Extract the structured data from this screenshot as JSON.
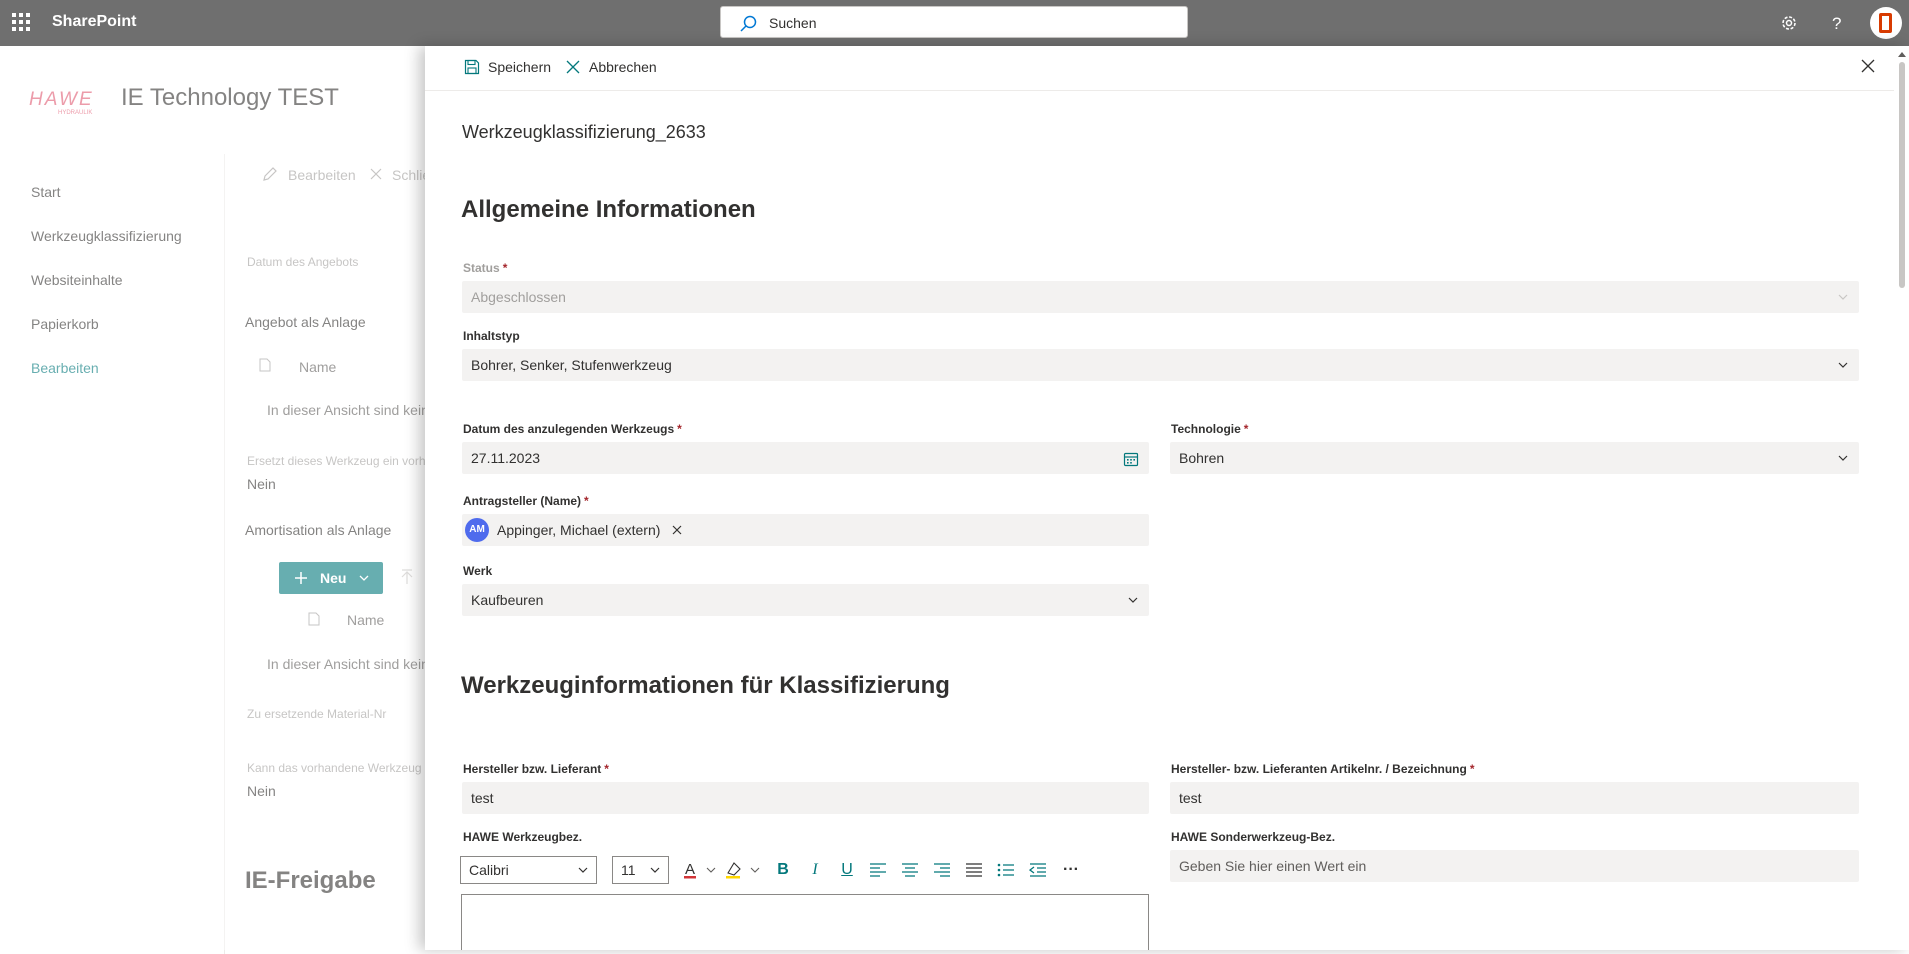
{
  "suitebar": {
    "app_name": "SharePoint",
    "search_placeholder": "Suchen"
  },
  "site": {
    "title": "IE Technology TEST",
    "logo_text": "HAWE",
    "logo_subtext": "HYDRAULIK"
  },
  "leftnav": {
    "items": [
      "Start",
      "Werkzeugklassifizierung",
      "Websiteinhalte",
      "Papierkorb",
      "Bearbeiten"
    ]
  },
  "background": {
    "cmd_edit": "Bearbeiten",
    "cmd_close": "Schlie",
    "datum_angebot_label": "Datum des Angebots",
    "angebot_anlage": "Angebot als Anlage",
    "name_col": "Name",
    "empty_view": "In dieser Ansicht sind kein",
    "ersetzt_label": "Ersetzt dieses Werkzeug ein vorh",
    "nein_1": "Nein",
    "amortisation": "Amortisation als Anlage",
    "neu_button": "Neu",
    "name_col_2": "Name",
    "empty_view_2": "In dieser Ansicht sind kein",
    "material_label": "Zu ersetzende Material-Nr",
    "kann_label": "Kann das vorhandene Werkzeug",
    "nein_2": "Nein",
    "ie_freigabe": "IE-Freigabe"
  },
  "panel": {
    "save_label": "Speichern",
    "cancel_label": "Abbrechen",
    "form_title": "Werkzeugklassifizierung_2633",
    "section_general": "Allgemeine Informationen",
    "section_tool": "Werkzeuginformationen für Klassifizierung",
    "fields": {
      "status": {
        "label": "Status",
        "value": "Abgeschlossen"
      },
      "inhaltstyp": {
        "label": "Inhaltstyp",
        "value": "Bohrer,  Senker, Stufenwerkzeug"
      },
      "datum": {
        "label": "Datum des anzulegenden Werkzeugs",
        "value": "27.11.2023"
      },
      "technologie": {
        "label": "Technologie",
        "value": "Bohren"
      },
      "antragsteller": {
        "label": "Antragsteller (Name)",
        "initials": "AM",
        "value": "Appinger, Michael (extern)"
      },
      "werk": {
        "label": "Werk",
        "value": "Kaufbeuren"
      },
      "hersteller": {
        "label": "Hersteller bzw. Lieferant",
        "value": "test"
      },
      "artikelnr": {
        "label": "Hersteller- bzw. Lieferanten Artikelnr. / Bezeichnung",
        "value": "test"
      },
      "hawe_bez": {
        "label": "HAWE Werkzeugbez."
      },
      "sonder_bez": {
        "label": "HAWE Sonderwerkzeug-Bez.",
        "placeholder": "Geben Sie hier einen Wert ein"
      }
    },
    "rte": {
      "font": "Calibri",
      "size": "11",
      "more": "···"
    }
  },
  "colors": {
    "suitebar": "#6f6f6f",
    "accent": "#03787c",
    "required": "#a4262c",
    "persona": "#4f6bed"
  }
}
